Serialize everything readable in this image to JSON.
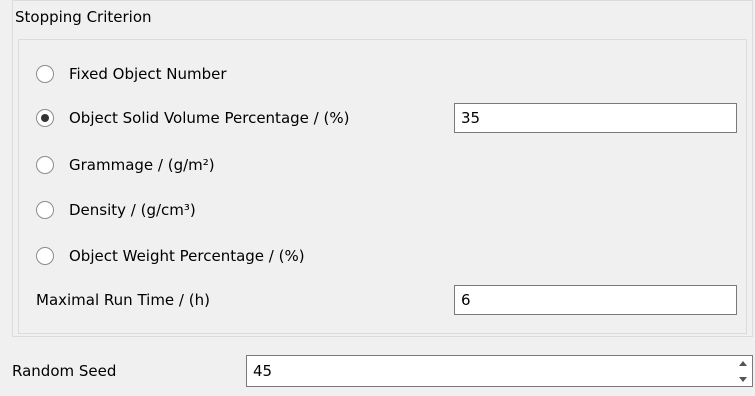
{
  "stopping_criterion": {
    "title": "Stopping Criterion",
    "options": [
      {
        "label": "Fixed Object Number",
        "checked": false
      },
      {
        "label": "Object Solid Volume Percentage / (%)",
        "checked": true,
        "value": "35"
      },
      {
        "label": "Grammage / (g/m²)",
        "checked": false
      },
      {
        "label": "Density / (g/cm³)",
        "checked": false
      },
      {
        "label": "Object Weight Percentage / (%)",
        "checked": false
      }
    ],
    "max_run_time": {
      "label": "Maximal Run Time / (h)",
      "value": "6"
    }
  },
  "random_seed": {
    "label": "Random Seed",
    "value": "45"
  }
}
